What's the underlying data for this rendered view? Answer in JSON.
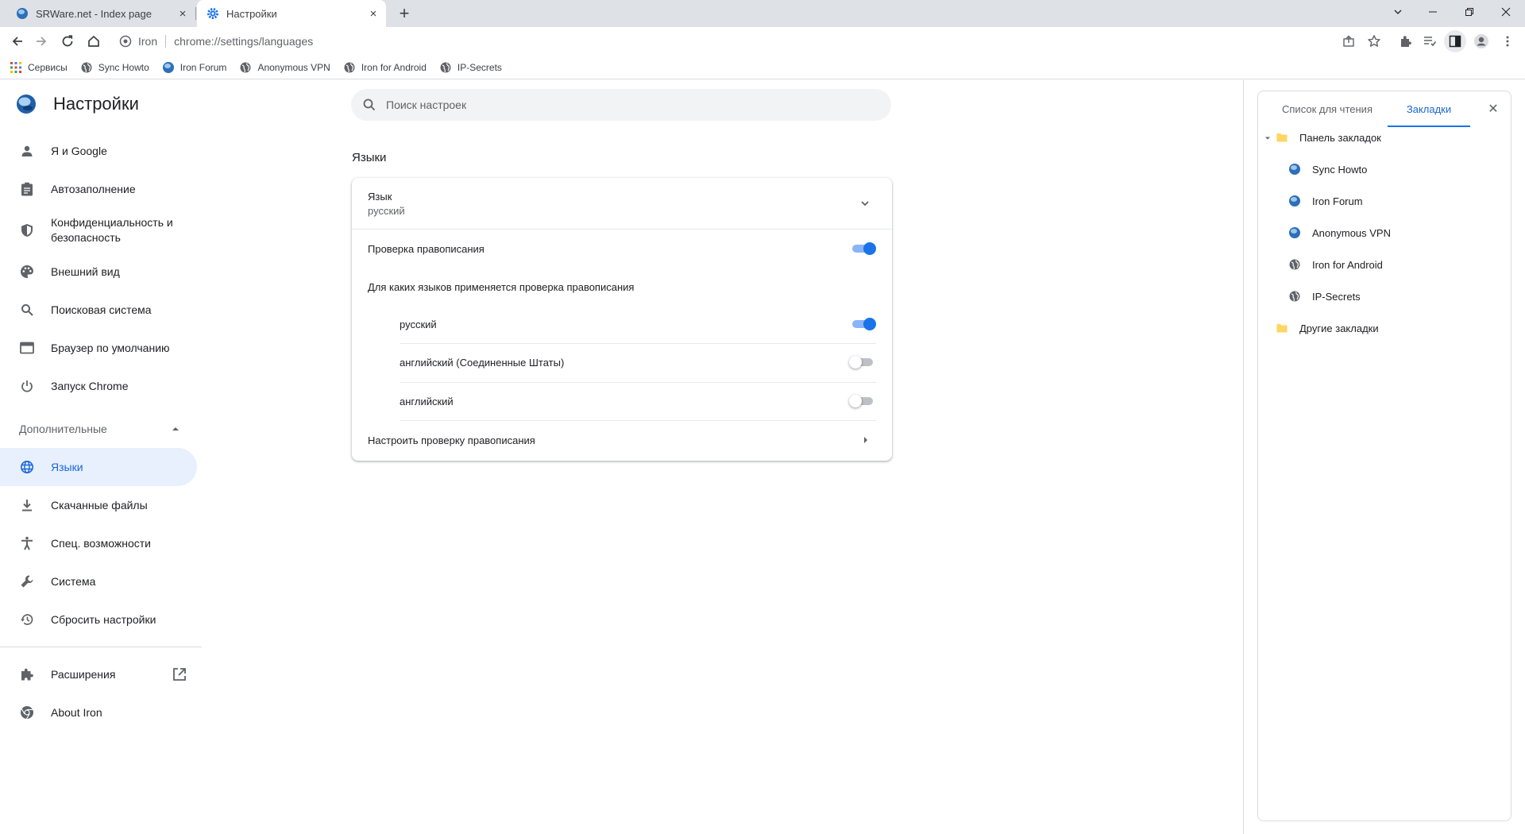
{
  "tabs": [
    {
      "title": "SRWare.net - Index page",
      "close": "×"
    },
    {
      "title": "Настройки",
      "close": "×"
    }
  ],
  "new_tab": "+",
  "omnibox": {
    "site": "Iron",
    "url": "chrome://settings/languages"
  },
  "bookmarks_bar": [
    {
      "label": "Сервисы",
      "icon": "apps-grid-icon"
    },
    {
      "label": "Sync Howto",
      "icon": "globe-icon"
    },
    {
      "label": "Iron Forum",
      "icon": "iron-logo-icon"
    },
    {
      "label": "Anonymous VPN",
      "icon": "globe-icon"
    },
    {
      "label": "Iron for Android",
      "icon": "globe-icon"
    },
    {
      "label": "IP-Secrets",
      "icon": "globe-icon"
    }
  ],
  "settings": {
    "title": "Настройки",
    "search_placeholder": "Поиск настроек",
    "nav": [
      {
        "label": "Я и Google",
        "icon": "person-icon"
      },
      {
        "label": "Автозаполнение",
        "icon": "clipboard-icon"
      },
      {
        "label": "Конфиденциальность и безопасность",
        "icon": "shield-icon"
      },
      {
        "label": "Внешний вид",
        "icon": "palette-icon"
      },
      {
        "label": "Поисковая система",
        "icon": "search-icon"
      },
      {
        "label": "Браузер по умолчанию",
        "icon": "browser-icon"
      },
      {
        "label": "Запуск Chrome",
        "icon": "power-icon"
      }
    ],
    "advanced_label": "Дополнительные",
    "advanced_nav": [
      {
        "label": "Языки",
        "icon": "globe-icon"
      },
      {
        "label": "Скачанные файлы",
        "icon": "download-icon"
      },
      {
        "label": "Спец. возможности",
        "icon": "accessibility-icon"
      },
      {
        "label": "Система",
        "icon": "wrench-icon"
      },
      {
        "label": "Сбросить настройки",
        "icon": "history-icon"
      }
    ],
    "extensions_label": "Расширения",
    "about_label": "About Iron"
  },
  "languages": {
    "section_title": "Языки",
    "language_label": "Язык",
    "language_value": "русский",
    "spellcheck_label": "Проверка правописания",
    "spellcheck_on": true,
    "spellcheck_langs_label": "Для каких языков применяется проверка правописания",
    "spellcheck_langs": [
      {
        "label": "русский",
        "enabled": true
      },
      {
        "label": "английский (Соединенные Штаты)",
        "enabled": false
      },
      {
        "label": "английский",
        "enabled": false
      }
    ],
    "customize_spellcheck_label": "Настроить проверку правописания"
  },
  "side_panel": {
    "tabs": [
      "Список для чтения",
      "Закладки"
    ],
    "active_tab": "Закладки",
    "close": "✕",
    "folders": [
      {
        "label": "Панель закладок",
        "expanded": true,
        "items": [
          "Sync Howto",
          "Iron Forum",
          "Anonymous VPN",
          "Iron for Android",
          "IP-Secrets"
        ]
      },
      {
        "label": "Другие закладки",
        "expanded": false,
        "items": []
      }
    ]
  },
  "colors": {
    "accent": "#1a73e8",
    "active_nav_bg": "#e8f0fe",
    "tabstrip_bg": "#dee1e6"
  }
}
